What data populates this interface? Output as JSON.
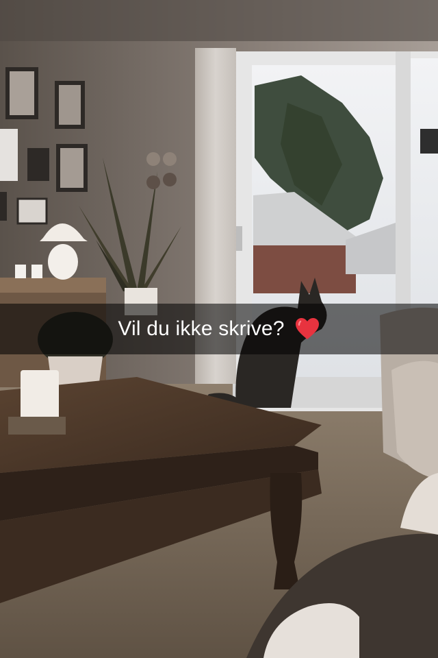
{
  "caption": {
    "text": "Vil du ikke skrive?",
    "emoji": "red-heart-icon",
    "emoji_color": "#e8333f"
  },
  "colors": {
    "wall": "#6b625a",
    "window_light": "#e9ecef",
    "floor": "#7a6a59",
    "table": "#4a3526",
    "caption_bg": "rgba(0,0,0,0.55)"
  }
}
